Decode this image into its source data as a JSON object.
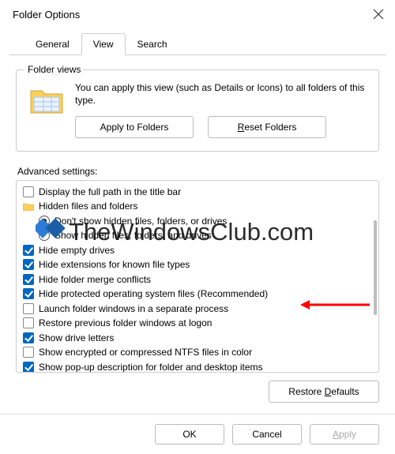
{
  "window": {
    "title": "Folder Options"
  },
  "tabs": [
    {
      "label": "General"
    },
    {
      "label": "View"
    },
    {
      "label": "Search"
    }
  ],
  "folder_views": {
    "group_label": "Folder views",
    "description": "You can apply this view (such as Details or Icons) to all folders of this type.",
    "apply_btn": "Apply to Folders",
    "reset_btn": "Reset Folders"
  },
  "advanced": {
    "label": "Advanced settings:",
    "items": [
      {
        "type": "checkbox",
        "checked": false,
        "label": "Display the full path in the title bar"
      },
      {
        "type": "folder",
        "label": "Hidden files and folders"
      },
      {
        "type": "radio",
        "checked": true,
        "indent": true,
        "label": "Don't show hidden files, folders, or drives"
      },
      {
        "type": "radio",
        "checked": false,
        "indent": true,
        "label": "Show hidden files, folders, and drives"
      },
      {
        "type": "checkbox",
        "checked": true,
        "label": "Hide empty drives"
      },
      {
        "type": "checkbox",
        "checked": true,
        "label": "Hide extensions for known file types"
      },
      {
        "type": "checkbox",
        "checked": true,
        "label": "Hide folder merge conflicts"
      },
      {
        "type": "checkbox",
        "checked": true,
        "label": "Hide protected operating system files (Recommended)"
      },
      {
        "type": "checkbox",
        "checked": false,
        "label": "Launch folder windows in a separate process"
      },
      {
        "type": "checkbox",
        "checked": false,
        "label": "Restore previous folder windows at logon"
      },
      {
        "type": "checkbox",
        "checked": true,
        "label": "Show drive letters"
      },
      {
        "type": "checkbox",
        "checked": false,
        "label": "Show encrypted or compressed NTFS files in color"
      },
      {
        "type": "checkbox",
        "checked": true,
        "label": "Show pop-up description for folder and desktop items"
      }
    ],
    "restore_defaults": "Restore Defaults"
  },
  "footer": {
    "ok": "OK",
    "cancel": "Cancel",
    "apply": "Apply"
  },
  "watermark": "TheWindowsClub.com"
}
